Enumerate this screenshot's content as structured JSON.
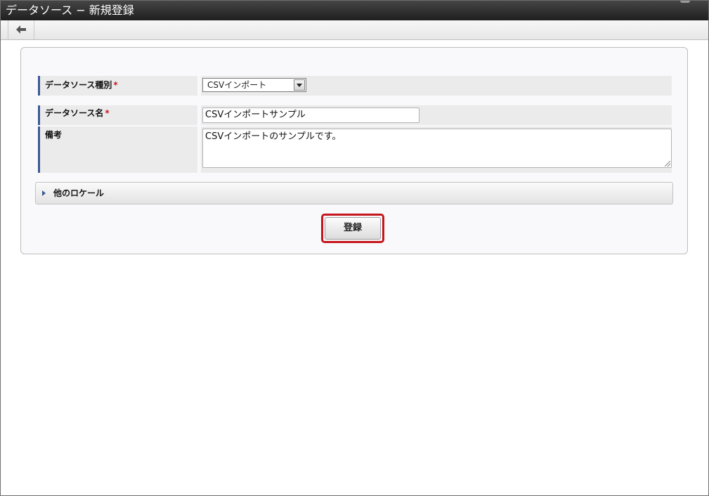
{
  "window": {
    "title": "データソース − 新規登録"
  },
  "toolbar": {
    "back_icon": "back-arrow-icon"
  },
  "form": {
    "required_mark": "*",
    "type": {
      "label": "データソース種別",
      "value": "CSVインポート"
    },
    "name": {
      "label": "データソース名",
      "value": "CSVインポートサンプル"
    },
    "note": {
      "label": "備考",
      "value": "CSVインポートのサンプルです。"
    },
    "other_locales": {
      "label": "他のロケール",
      "icon": "caret-right-icon"
    },
    "submit_label": "登録"
  },
  "colors": {
    "label_accent": "#3a5a95",
    "required": "#d0151b",
    "highlight": "#c4161c",
    "titlebar": "#2b2b2b"
  }
}
